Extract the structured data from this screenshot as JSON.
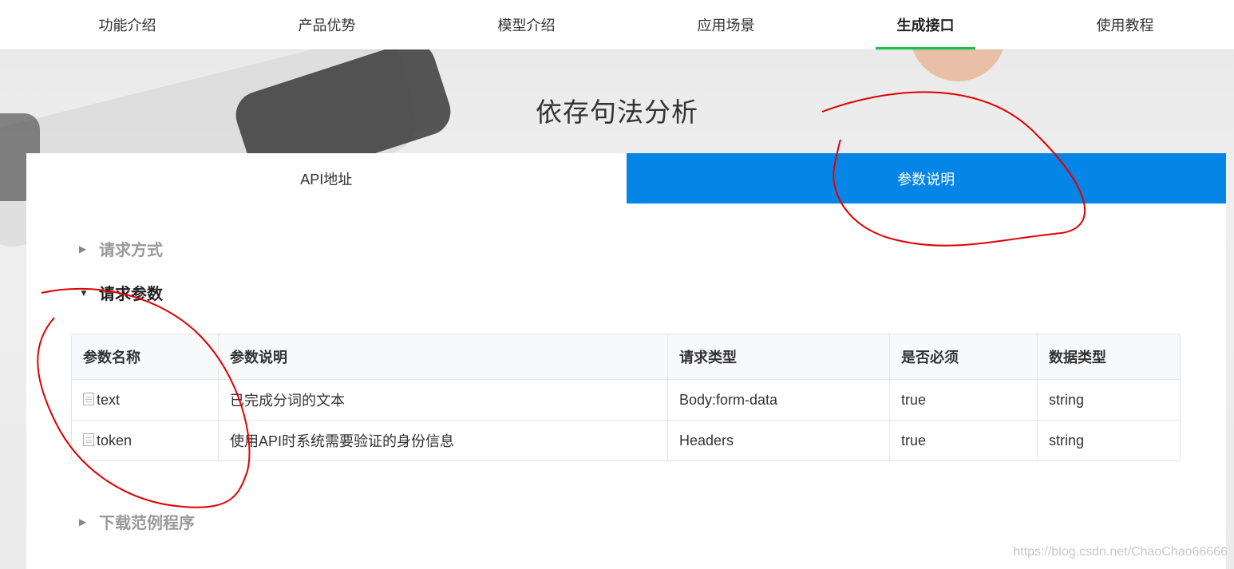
{
  "nav": {
    "items": [
      {
        "label": "功能介绍"
      },
      {
        "label": "产品优势"
      },
      {
        "label": "模型介绍"
      },
      {
        "label": "应用场景"
      },
      {
        "label": "生成接口",
        "active": true
      },
      {
        "label": "使用教程"
      }
    ],
    "active_color": "#1bbf4c"
  },
  "page_title": "依存句法分析",
  "tabs": {
    "api_address": "API地址",
    "param_desc": "参数说明",
    "active_color": "#0585e6"
  },
  "sections": {
    "request_method": "请求方式",
    "request_params": "请求参数",
    "download_sample": "下载范例程序"
  },
  "table": {
    "headers": [
      "参数名称",
      "参数说明",
      "请求类型",
      "是否必须",
      "数据类型"
    ],
    "rows": [
      {
        "name": "text",
        "desc": "已完成分词的文本",
        "req_type": "Body:form-data",
        "required": "true",
        "data_type": "string"
      },
      {
        "name": "token",
        "desc": "使用API时系统需要验证的身份信息",
        "req_type": "Headers",
        "required": "true",
        "data_type": "string"
      }
    ]
  },
  "watermark": "https://blog.csdn.net/ChaoChao66666",
  "colors": {
    "purple": "#7a2be6",
    "red": "#e6261f",
    "annotation": "#e00000"
  }
}
